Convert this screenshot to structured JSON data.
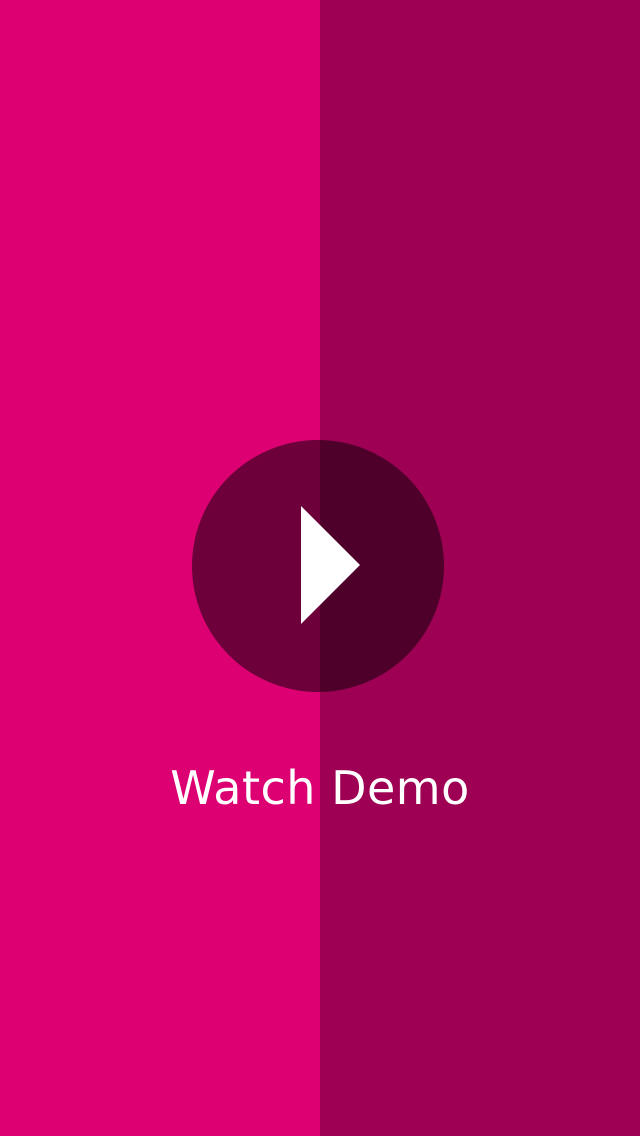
{
  "demo": {
    "label": "Watch Demo",
    "play_icon": "play-icon"
  },
  "colors": {
    "left_background": "#DC0073",
    "right_background": "#9E0054",
    "circle_left": "#6D003A",
    "circle_right": "#4E002A",
    "play_triangle": "#FFFFFF",
    "label": "#FFFFFF"
  }
}
